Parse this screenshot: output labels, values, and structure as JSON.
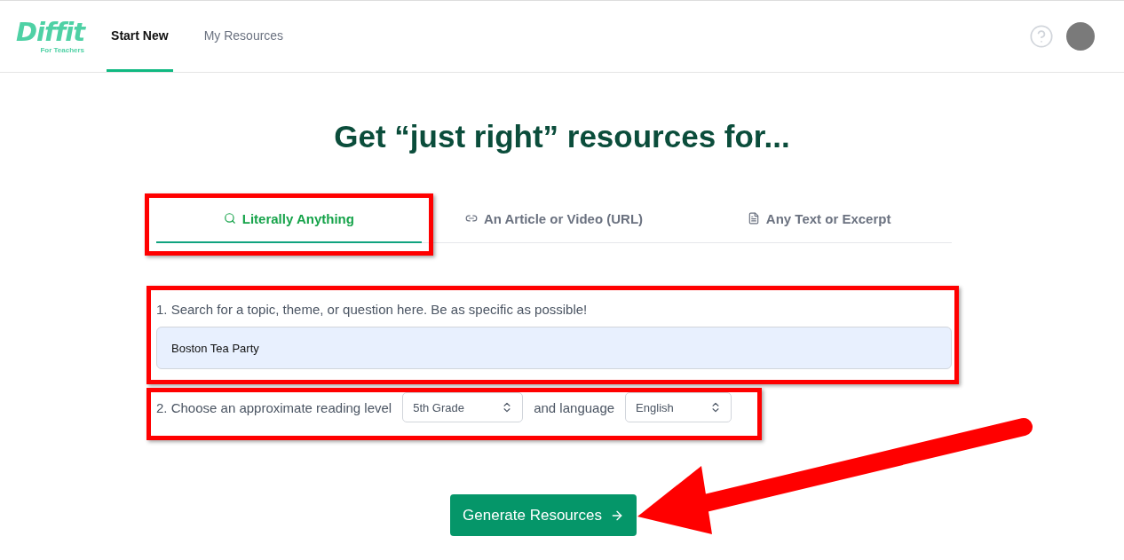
{
  "logo": {
    "name": "Diffit",
    "tagline": "For Teachers"
  },
  "nav": [
    {
      "label": "Start New",
      "selected": true
    },
    {
      "label": "My Resources",
      "selected": false
    }
  ],
  "headline": "Get “just right” resources for...",
  "tabs": [
    {
      "label": "Literally Anything",
      "kind": "search",
      "selected": true
    },
    {
      "label": "An Article or Video (URL)",
      "kind": "link",
      "selected": false
    },
    {
      "label": "Any Text or Excerpt",
      "kind": "document",
      "selected": false
    }
  ],
  "search": {
    "label": "1. Search for a topic, theme, or question here. Be as specific as possible!",
    "value": "Boston Tea Party"
  },
  "level": {
    "label": "2. Choose an approximate reading level",
    "value": "5th Grade",
    "joiner": "and language",
    "language": "English"
  },
  "button": {
    "label": "Generate Resources"
  }
}
